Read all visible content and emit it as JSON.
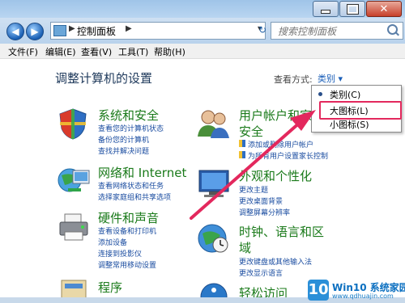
{
  "window": {
    "buttons": {
      "minimize": "",
      "maximize": "",
      "close": "✕"
    }
  },
  "navbar": {
    "address": {
      "path": "控制面板",
      "separator": "▶"
    },
    "search_placeholder": "搜索控制面板"
  },
  "menubar": {
    "items": [
      "文件(F)",
      "编辑(E)",
      "查看(V)",
      "工具(T)",
      "帮助(H)"
    ]
  },
  "main": {
    "heading": "调整计算机的设置",
    "view_by_label": "查看方式:",
    "view_by_value": "类别 ▾",
    "view_menu": {
      "items": [
        "类别(C)",
        "大图标(L)",
        "小图标(S)"
      ],
      "selected_index": 0,
      "highlighted_index": 1
    },
    "categories": [
      {
        "title": "系统和安全",
        "links": [
          "查看您的计算机状态",
          "备份您的计算机",
          "查找并解决问题"
        ]
      },
      {
        "title": "网络和 Internet",
        "links": [
          "查看网络状态和任务",
          "选择家庭组和共享选项"
        ]
      },
      {
        "title": "硬件和声音",
        "links": [
          "查看设备和打印机",
          "添加设备",
          "连接到投影仪",
          "调整常用移动设置"
        ]
      },
      {
        "title": "程序",
        "links": []
      },
      {
        "title_line1": "用户帐户和家",
        "title_line2": "安全",
        "links": [
          "添加或删除用户帐户",
          "为所有用户设置家长控制"
        ]
      },
      {
        "title": "外观和个性化",
        "links": [
          "更改主题",
          "更改桌面背景",
          "调整屏幕分辨率"
        ]
      },
      {
        "title_line1": "时钟、语言和区",
        "title_line2": "域",
        "links": [
          "更改键盘或其他输入法",
          "更改显示语言"
        ]
      },
      {
        "title": "轻松访问",
        "links": []
      }
    ]
  },
  "annotation": {
    "color": "#e3285d"
  },
  "watermark": {
    "logo": "10",
    "text": "Win10 系统家园",
    "url": "www.qdhuajin.com"
  }
}
